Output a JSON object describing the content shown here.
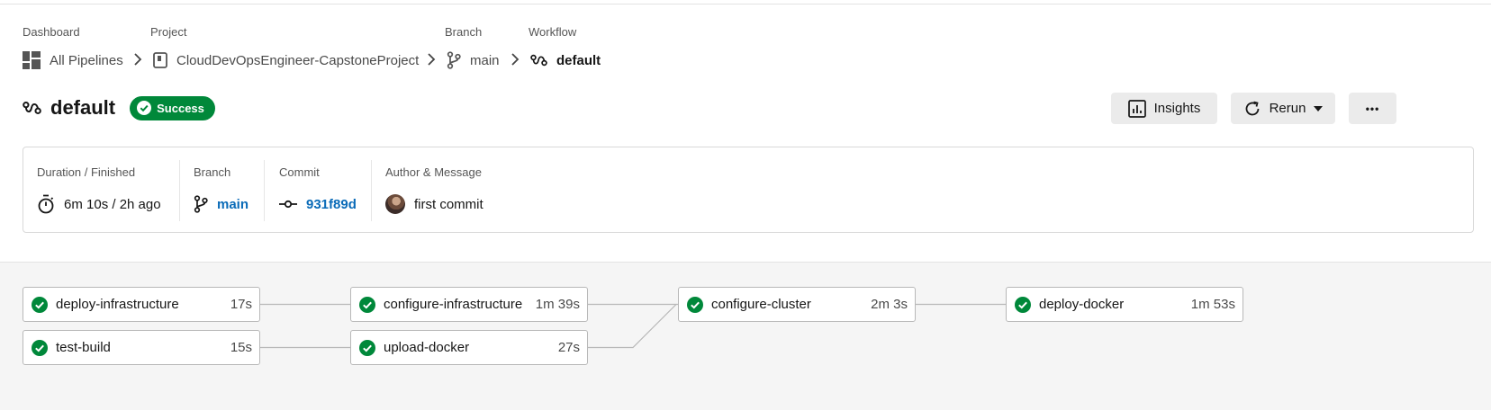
{
  "breadcrumbs": {
    "dashboard": {
      "label": "Dashboard",
      "value": "All Pipelines"
    },
    "project": {
      "label": "Project",
      "value": "CloudDevOpsEngineer-CapstoneProject"
    },
    "branch": {
      "label": "Branch",
      "value": "main"
    },
    "workflow": {
      "label": "Workflow",
      "value": "default"
    }
  },
  "header": {
    "title": "default",
    "status": "Success",
    "insights_label": "Insights",
    "rerun_label": "Rerun",
    "more_label": "•••"
  },
  "summary": {
    "duration": {
      "label": "Duration / Finished",
      "value": "6m 10s / 2h ago"
    },
    "branch": {
      "label": "Branch",
      "value": "main"
    },
    "commit": {
      "label": "Commit",
      "value": "931f89d"
    },
    "author": {
      "label": "Author & Message",
      "value": "first commit"
    }
  },
  "jobs": [
    {
      "name": "deploy-infrastructure",
      "duration": "17s"
    },
    {
      "name": "test-build",
      "duration": "15s"
    },
    {
      "name": "configure-infrastructure",
      "duration": "1m 39s"
    },
    {
      "name": "upload-docker",
      "duration": "27s"
    },
    {
      "name": "configure-cluster",
      "duration": "2m 3s"
    },
    {
      "name": "deploy-docker",
      "duration": "1m 53s"
    }
  ],
  "colors": {
    "success": "#00883a",
    "link": "#0a6bb8",
    "status_icon": "check-circle-icon"
  }
}
